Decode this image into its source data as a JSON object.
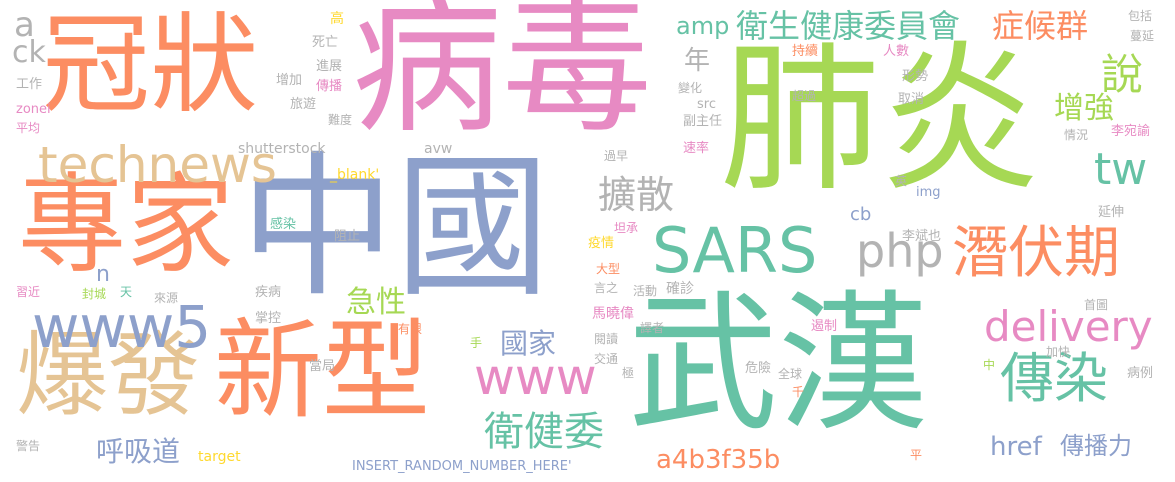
{
  "palette": {
    "teal": "#66c2a5",
    "orange": "#fc8d62",
    "blue": "#8da0cb",
    "pink": "#e78ac3",
    "green": "#a6d854",
    "yellow": "#ffd92f",
    "tan": "#e5c494",
    "gray": "#b3b3b3"
  },
  "words": [
    {
      "text": "病毒",
      "color": "pink"
    },
    {
      "text": "肺炎",
      "color": "green"
    },
    {
      "text": "武漢",
      "color": "teal"
    },
    {
      "text": "中國",
      "color": "blue"
    },
    {
      "text": "冠狀",
      "color": "orange"
    },
    {
      "text": "專家",
      "color": "orange"
    },
    {
      "text": "新型",
      "color": "orange"
    },
    {
      "text": "爆發",
      "color": "tan"
    },
    {
      "text": "technews",
      "color": "tan"
    },
    {
      "text": "www5",
      "color": "blue"
    },
    {
      "text": "SARS",
      "color": "teal"
    },
    {
      "text": "潛伏期",
      "color": "orange"
    },
    {
      "text": "傳染",
      "color": "teal"
    },
    {
      "text": "www",
      "color": "pink"
    },
    {
      "text": "php",
      "color": "gray"
    },
    {
      "text": "delivery",
      "color": "pink"
    },
    {
      "text": "tw",
      "color": "teal"
    },
    {
      "text": "衛生健康委員會",
      "color": "teal"
    },
    {
      "text": "症候群",
      "color": "orange"
    },
    {
      "text": "說",
      "color": "green"
    },
    {
      "text": "擴散",
      "color": "gray"
    },
    {
      "text": "增強",
      "color": "green"
    },
    {
      "text": "衛健委",
      "color": "teal"
    },
    {
      "text": "急性",
      "color": "green"
    },
    {
      "text": "國家",
      "color": "blue"
    },
    {
      "text": "呼吸道",
      "color": "blue"
    },
    {
      "text": "href",
      "color": "blue"
    },
    {
      "text": "傳播力",
      "color": "blue"
    },
    {
      "text": "a4b3f35b",
      "color": "orange"
    },
    {
      "text": "amp",
      "color": "teal"
    },
    {
      "text": "年",
      "color": "gray"
    },
    {
      "text": "a",
      "color": "gray"
    },
    {
      "text": "ck",
      "color": "gray"
    },
    {
      "text": "n",
      "color": "blue"
    },
    {
      "text": "cb",
      "color": "blue"
    },
    {
      "text": "_blank'",
      "color": "yellow"
    },
    {
      "text": "shutterstock",
      "color": "gray"
    },
    {
      "text": "avw",
      "color": "gray"
    },
    {
      "text": "src",
      "color": "gray"
    },
    {
      "text": "img",
      "color": "blue"
    },
    {
      "text": "zonei",
      "color": "pink"
    },
    {
      "text": "target",
      "color": "yellow"
    },
    {
      "text": "INSERT_RANDOM_NUMBER_HERE'",
      "color": "blue"
    },
    {
      "text": "高",
      "color": "yellow"
    },
    {
      "text": "死亡",
      "color": "gray"
    },
    {
      "text": "工作",
      "color": "gray"
    },
    {
      "text": "平均",
      "color": "pink"
    },
    {
      "text": "進展",
      "color": "gray"
    },
    {
      "text": "傳播",
      "color": "pink"
    },
    {
      "text": "增加",
      "color": "gray"
    },
    {
      "text": "旅遊",
      "color": "gray"
    },
    {
      "text": "難度",
      "color": "gray"
    },
    {
      "text": "感染",
      "color": "teal"
    },
    {
      "text": "阻止",
      "color": "gray"
    },
    {
      "text": "習近",
      "color": "pink"
    },
    {
      "text": "封城",
      "color": "green"
    },
    {
      "text": "天",
      "color": "teal"
    },
    {
      "text": "來源",
      "color": "gray"
    },
    {
      "text": "疾病",
      "color": "gray"
    },
    {
      "text": "掌控",
      "color": "gray"
    },
    {
      "text": "當局",
      "color": "gray"
    },
    {
      "text": "有限",
      "color": "orange"
    },
    {
      "text": "警告",
      "color": "gray"
    },
    {
      "text": "手",
      "color": "green"
    },
    {
      "text": "疫情",
      "color": "yellow"
    },
    {
      "text": "坦承",
      "color": "pink"
    },
    {
      "text": "大型",
      "color": "orange"
    },
    {
      "text": "言之",
      "color": "gray"
    },
    {
      "text": "活動",
      "color": "gray"
    },
    {
      "text": "確診",
      "color": "gray"
    },
    {
      "text": "馬曉偉",
      "color": "pink"
    },
    {
      "text": "閱讀",
      "color": "gray"
    },
    {
      "text": "譯者",
      "color": "gray"
    },
    {
      "text": "交通",
      "color": "gray"
    },
    {
      "text": "極",
      "color": "gray"
    },
    {
      "text": "過早",
      "color": "gray"
    },
    {
      "text": "速率",
      "color": "pink"
    },
    {
      "text": "副主任",
      "color": "gray"
    },
    {
      "text": "變化",
      "color": "gray"
    },
    {
      "text": "持續",
      "color": "orange"
    },
    {
      "text": "超過",
      "color": "gray"
    },
    {
      "text": "人數",
      "color": "pink"
    },
    {
      "text": "形勢",
      "color": "gray"
    },
    {
      "text": "取消",
      "color": "gray"
    },
    {
      "text": "蔓延",
      "color": "gray"
    },
    {
      "text": "包括",
      "color": "gray"
    },
    {
      "text": "情況",
      "color": "gray"
    },
    {
      "text": "李宛諭",
      "color": "pink"
    },
    {
      "text": "英",
      "color": "gray"
    },
    {
      "text": "延伸",
      "color": "gray"
    },
    {
      "text": "李斌也",
      "color": "gray"
    },
    {
      "text": "首圖",
      "color": "gray"
    },
    {
      "text": "遏制",
      "color": "pink"
    },
    {
      "text": "加快",
      "color": "gray"
    },
    {
      "text": "危險",
      "color": "gray"
    },
    {
      "text": "全球",
      "color": "gray"
    },
    {
      "text": "中",
      "color": "green"
    },
    {
      "text": "千",
      "color": "orange"
    },
    {
      "text": "病例",
      "color": "gray"
    },
    {
      "text": "平",
      "color": "orange"
    }
  ]
}
